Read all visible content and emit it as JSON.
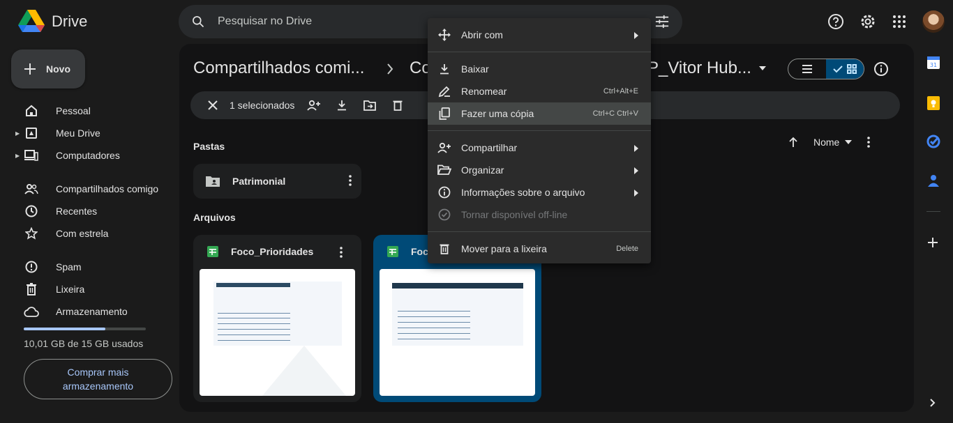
{
  "app": {
    "name": "Drive"
  },
  "search": {
    "placeholder": "Pesquisar no Drive"
  },
  "sidebar": {
    "new_label": "Novo",
    "items": [
      {
        "label": "Pessoal",
        "icon": "home-icon"
      },
      {
        "label": "Meu Drive",
        "icon": "drive-icon"
      },
      {
        "label": "Computadores",
        "icon": "computer-icon"
      },
      {
        "label": "Compartilhados comigo",
        "icon": "people-icon"
      },
      {
        "label": "Recentes",
        "icon": "clock-icon"
      },
      {
        "label": "Com estrela",
        "icon": "star-icon"
      },
      {
        "label": "Spam",
        "icon": "spam-icon"
      },
      {
        "label": "Lixeira",
        "icon": "trash-icon"
      },
      {
        "label": "Armazenamento",
        "icon": "cloud-icon"
      }
    ],
    "storage_text": "10,01 GB de 15 GB usados",
    "storage_used_fraction": 0.667,
    "buy_label": "Comprar mais armazenamento"
  },
  "breadcrumb": {
    "first": "Compartilhados comi...",
    "second": "Co",
    "current": "P_Vitor Hub..."
  },
  "selection": {
    "count_label": "1 selecionados"
  },
  "sections": {
    "folders": "Pastas",
    "files": "Arquivos"
  },
  "sort": {
    "label": "Nome"
  },
  "folders": [
    {
      "name": "Patrimonial"
    }
  ],
  "files": [
    {
      "name": "Foco_Prioridades"
    },
    {
      "name": "Foc"
    }
  ],
  "context_menu": {
    "items": [
      {
        "label": "Abrir com",
        "submenu": true
      },
      {
        "label": "Baixar"
      },
      {
        "label": "Renomear",
        "shortcut": "Ctrl+Alt+E"
      },
      {
        "label": "Fazer uma cópia",
        "shortcut": "Ctrl+C Ctrl+V"
      },
      {
        "label": "Compartilhar",
        "submenu": true
      },
      {
        "label": "Organizar",
        "submenu": true
      },
      {
        "label": "Informações sobre o arquivo",
        "submenu": true
      },
      {
        "label": "Tornar disponível off-line"
      },
      {
        "label": "Mover para a lixeira",
        "shortcut": "Delete"
      }
    ]
  },
  "colors": {
    "accent": "#a8c7fa",
    "selected": "#004a77",
    "background": "#1b1b1b"
  }
}
